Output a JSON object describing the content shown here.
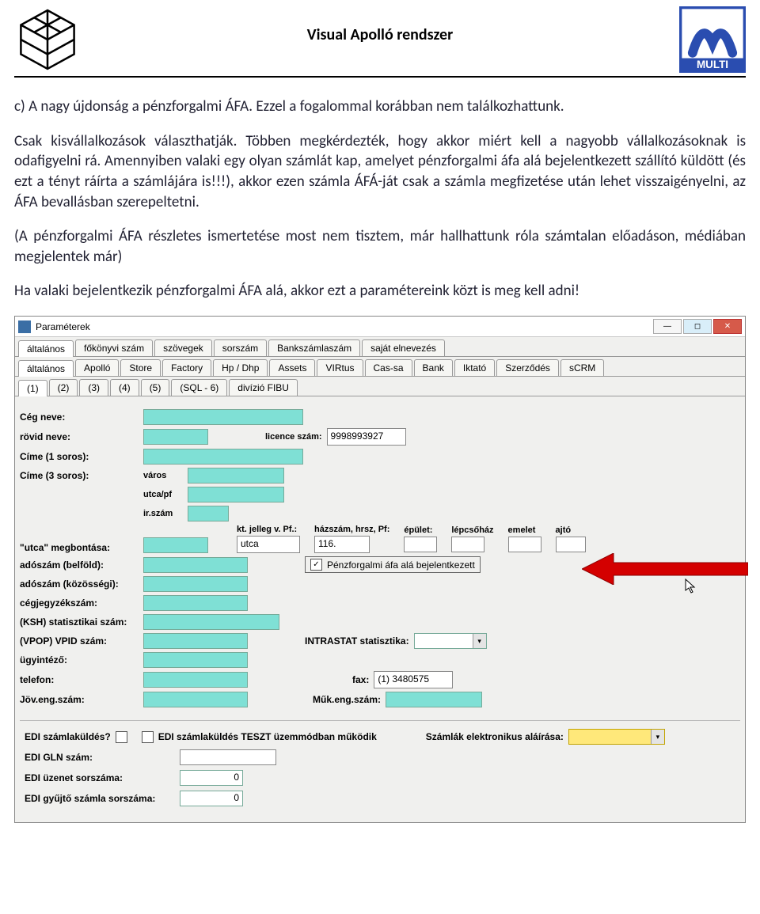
{
  "header": {
    "title": "Visual Apolló rendszer",
    "logoRight": "MULTI"
  },
  "paragraphs": {
    "p1": "c) A nagy újdonság a pénzforgalmi ÁFA. Ezzel a fogalommal korábban nem találkozhattunk.",
    "p2": "Csak kisvállalkozások választhatják. Többen megkérdezték, hogy akkor miért kell a nagyobb vállalkozásoknak is odafigyelni rá. Amennyiben valaki egy olyan számlát kap, amelyet pénzforgalmi áfa alá bejelentkezett szállító küldött (és ezt a tényt ráírta a számlájára is!!!), akkor ezen számla ÁFÁ-ját csak a számla megfizetése után lehet visszaigényelni, az ÁFA bevallásban szerepeltetni.",
    "p3": "(A pénzforgalmi ÁFA részletes ismertetése most nem tisztem, már hallhattunk róla számtalan előadáson, médiában megjelentek már)",
    "p4": "Ha valaki bejelentkezik pénzforgalmi ÁFA alá, akkor ezt a paramétereink közt is meg kell adni!"
  },
  "win": {
    "title": "Paraméterek",
    "btn": {
      "min": "—",
      "max": "◻",
      "close": "✕"
    },
    "tabs1": [
      "általános",
      "főkönyvi szám",
      "szövegek",
      "sorszám",
      "Bankszámlaszám",
      "saját elnevezés"
    ],
    "tabs2": [
      "általános",
      "Apolló",
      "Store",
      "Factory",
      "Hp / Dhp",
      "Assets",
      "VIRtus",
      "Cas-sa",
      "Bank",
      "Iktató",
      "Szerződés",
      "sCRM"
    ],
    "tabs3": [
      "(1)",
      "(2)",
      "(3)",
      "(4)",
      "(5)",
      "(SQL - 6)",
      "divízió FIBU"
    ],
    "labels": {
      "cegNeve": "Cég neve:",
      "rovidNeve": "rövid neve:",
      "licence": "licence szám:",
      "licenceVal": "9998993927",
      "cime1": "Címe (1 soros):",
      "cime3": "Címe (3 soros):",
      "varos": "város",
      "utcapf": "utca/pf",
      "irsz": "ir.szám",
      "utcaMeg": "\"utca\" megbontása:",
      "ktjelleg": "kt. jelleg v. Pf.:",
      "ktjellegVal": "utca",
      "hazszam": "házszám, hrsz, Pf:",
      "epulet": "épület:",
      "lepcsohaz": "lépcsőház",
      "emelet": "emelet",
      "ajto": "ajtó",
      "hazszamVal": "116.",
      "adoszamBel": "adószám (belföld):",
      "adoszamKoz": "adószám (közösségi):",
      "cegjegyzek": "cégjegyzékszám:",
      "ksh": "(KSH) statisztikai szám:",
      "vpop": "(VPOP) VPID szám:",
      "intrastat": "INTRASTAT statisztika:",
      "ugyintezo": "ügyintéző:",
      "telefon": "telefon:",
      "fax": "fax:",
      "faxVal": "(1) 3480575",
      "jovEng": "Jöv.eng.szám:",
      "mukEng": "Műk.eng.szám:",
      "penzforgalmi": "Pénzforgalmi áfa alá bejelentkezett"
    },
    "edi": {
      "kuldes": "EDI számlaküldés?",
      "teszt": "EDI számlaküldés TESZT üzemmódban működik",
      "alairas": "Számlák elektronikus aláírása:",
      "gln": "EDI GLN szám:",
      "uzenet": "EDI üzenet sorszáma:",
      "gyujto": "EDI gyűjtő számla sorszáma:",
      "zero": "0"
    }
  }
}
